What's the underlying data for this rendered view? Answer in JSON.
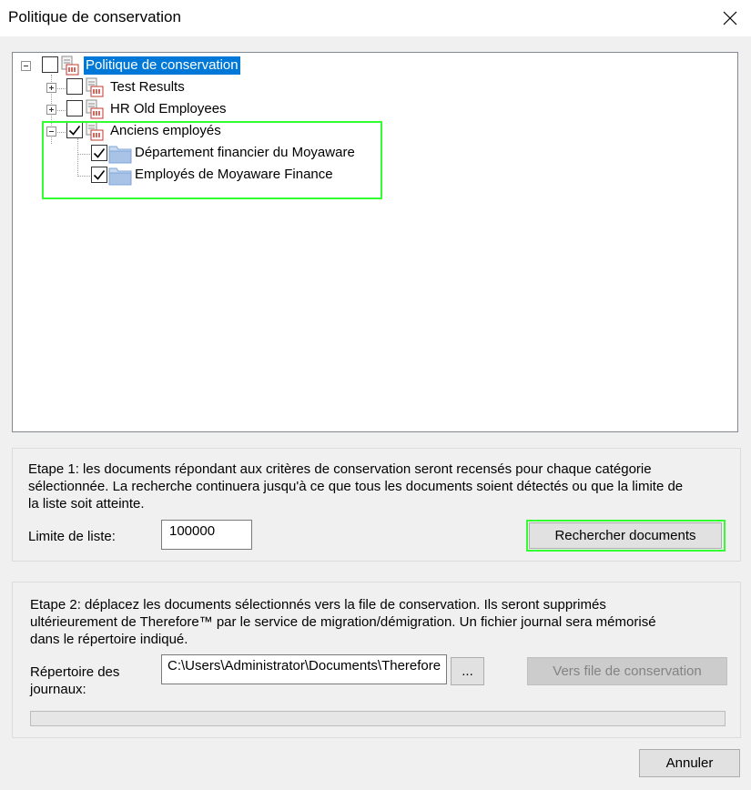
{
  "window": {
    "title": "Politique de conservation",
    "close_icon": "close-icon"
  },
  "tree": {
    "root": {
      "label": "Politique de conservation",
      "checked": false,
      "expanded": true,
      "icon": "retention-category-icon"
    },
    "items": [
      {
        "label": "Test Results",
        "checked": false,
        "expanded": false,
        "icon": "retention-category-icon"
      },
      {
        "label": "HR Old Employees",
        "checked": false,
        "expanded": false,
        "icon": "retention-category-icon"
      },
      {
        "label": "Anciens employés",
        "checked": true,
        "expanded": true,
        "icon": "retention-category-icon",
        "children": [
          {
            "label": "Département financier du Moyaware",
            "checked": true,
            "icon": "folder-icon"
          },
          {
            "label": "Employés de Moyaware Finance",
            "checked": true,
            "icon": "folder-icon"
          }
        ]
      }
    ]
  },
  "step1": {
    "description": "Etape 1: les documents répondant aux critères de conservation seront recensés pour chaque catégorie sélectionnée. La recherche continuera jusqu'à ce que tous les documents soient détectés ou que la limite de la liste soit atteinte.",
    "line1": "Etape 1: les documents répondant aux critères de conservation seront recensés pour chaque catégorie",
    "line2": "sélectionnée. La recherche continuera jusqu'à ce que tous les documents soient détectés ou que la limite de",
    "line3": "la liste soit atteinte.",
    "limit_label": "Limite de liste:",
    "limit_value": "100000",
    "search_button": "Rechercher documents"
  },
  "step2": {
    "line1": "Etape 2: déplacez les documents sélectionnés vers la file de conservation. Ils seront supprimés",
    "line2": "ultérieurement de Therefore™ par le service de migration/démigration. Un fichier journal sera mémorisé",
    "line3": "dans le répertoire indiqué.",
    "log_dir_label_1": "Répertoire des",
    "log_dir_label_2": "journaux:",
    "log_dir_value": "C:\\Users\\Administrator\\Documents\\Therefore",
    "browse_button": "...",
    "move_button": "Vers file de conservation",
    "progress": 0
  },
  "footer": {
    "cancel_button": "Annuler"
  },
  "colors": {
    "selection": "#0078d7",
    "highlight": "#32ff32",
    "folder": "#7ea6d9"
  }
}
